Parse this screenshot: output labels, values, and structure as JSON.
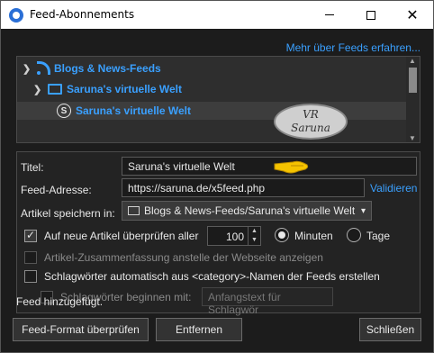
{
  "window": {
    "title": "Feed-Abonnements"
  },
  "more_link": "Mehr über Feeds erfahren...",
  "tree": {
    "items": [
      {
        "label": "Blogs & News-Feeds"
      },
      {
        "label": "Saruna's virtuelle Welt"
      },
      {
        "label": "Saruna's virtuelle Welt",
        "selected": true
      }
    ]
  },
  "watermark": {
    "line1": "VR",
    "line2": "Saruna"
  },
  "form": {
    "title_label": "Titel:",
    "title_value": "Saruna's virtuelle Welt",
    "address_label": "Feed-Adresse:",
    "address_value": "https://saruna.de/x5feed.php",
    "validate_label": "Validieren",
    "save_in_label": "Artikel speichern in:",
    "save_in_value": "Blogs & News-Feeds/Saruna's virtuelle Welt",
    "check_new_label": "Auf neue Artikel überprüfen aller",
    "check_new_checked": true,
    "interval_value": "100",
    "minutes_label": "Minuten",
    "days_label": "Tage",
    "interval_unit": "Minuten",
    "summary_label": "Artikel-Zusammenfassung anstelle der Webseite anzeigen",
    "summary_checked": false,
    "tags_label": "Schlagwörter automatisch aus <category>-Namen der Feeds erstellen",
    "tags_checked": false,
    "tags_prefix_label": "Schlagwörter beginnen mit:",
    "tags_prefix_placeholder": "Anfangstext für Schlagwör"
  },
  "status": "Feed hinzugefügt.",
  "buttons": {
    "check_format": "Feed-Format überprüfen",
    "remove": "Entfernen",
    "close": "Schließen"
  },
  "colors": {
    "accent": "#3aa0ff",
    "background": "#1c1c1c"
  }
}
